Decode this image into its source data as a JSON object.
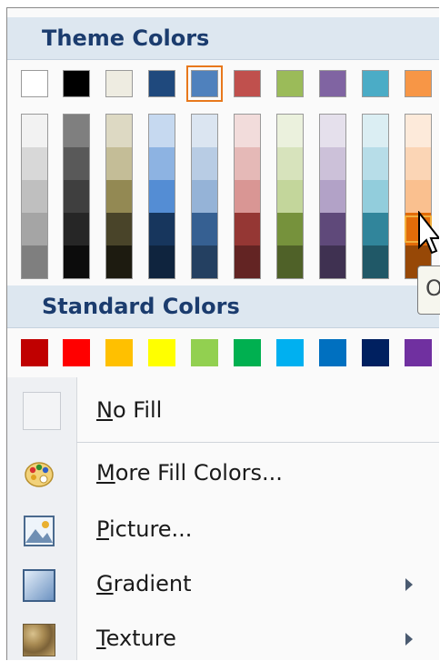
{
  "theme": {
    "title": "Theme Colors",
    "top_row": [
      "#ffffff",
      "#000000",
      "#eeece1",
      "#1f497d",
      "#4f81bd",
      "#c0504d",
      "#9bbb59",
      "#8064a2",
      "#4bacc6",
      "#f79646"
    ],
    "shades": [
      [
        "#f2f2f2",
        "#d8d8d8",
        "#bfbfbf",
        "#a5a5a5",
        "#7f7f7f"
      ],
      [
        "#7f7f7f",
        "#595959",
        "#3f3f3f",
        "#262626",
        "#0c0c0c"
      ],
      [
        "#ddd9c3",
        "#c4bd97",
        "#938953",
        "#494429",
        "#1d1b10"
      ],
      [
        "#c6d9f0",
        "#8db3e2",
        "#548dd4",
        "#17365d",
        "#0f243e"
      ],
      [
        "#dbe5f1",
        "#b8cce4",
        "#95b3d7",
        "#366092",
        "#244061"
      ],
      [
        "#f2dcdb",
        "#e5b9b7",
        "#d99694",
        "#953734",
        "#632423"
      ],
      [
        "#ebf1dd",
        "#d7e3bc",
        "#c3d69b",
        "#76923c",
        "#4f6128"
      ],
      [
        "#e5e0ec",
        "#ccc1d9",
        "#b2a2c7",
        "#5f497a",
        "#3f3151"
      ],
      [
        "#dbeef3",
        "#b7dde8",
        "#92cddc",
        "#31859b",
        "#205867"
      ],
      [
        "#fdeada",
        "#fbd5b5",
        "#fac08f",
        "#e36c09",
        "#974806"
      ]
    ],
    "selected_index": 4,
    "hover_col": 9,
    "hover_row": 3
  },
  "standard": {
    "title": "Standard Colors",
    "colors": [
      "#c00000",
      "#ff0000",
      "#ffc000",
      "#ffff00",
      "#92d050",
      "#00b050",
      "#00b0f0",
      "#0070c0",
      "#002060",
      "#7030a0"
    ]
  },
  "items": [
    {
      "label": "No Fill",
      "accel": "N",
      "rest": "o Fill",
      "icon": "no-fill-icon",
      "submenu": false
    },
    {
      "label": "More Fill Colors...",
      "accel": "M",
      "rest": "ore Fill Colors...",
      "icon": "palette-icon",
      "submenu": false
    },
    {
      "label": "Picture...",
      "accel": "P",
      "rest": "icture...",
      "icon": "picture-icon",
      "submenu": false
    },
    {
      "label": "Gradient",
      "accel": "G",
      "rest": "radient",
      "icon": "gradient-icon",
      "submenu": true
    },
    {
      "label": "Texture",
      "accel": "T",
      "rest": "exture",
      "icon": "texture-icon",
      "submenu": true
    }
  ],
  "tooltip": {
    "text": "O"
  }
}
